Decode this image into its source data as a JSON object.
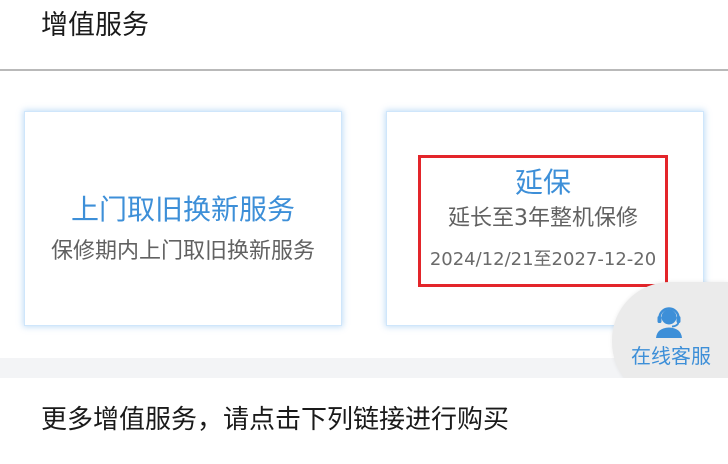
{
  "section": {
    "title": "增值服务"
  },
  "cards": [
    {
      "title": "上门取旧换新服务",
      "subtitle": "保修期内上门取旧换新服务"
    },
    {
      "title": "延保",
      "subtitle": "延长至3年整机保修",
      "date_range": "2024/12/21至2027-12-20"
    }
  ],
  "customer_service": {
    "label": "在线客服",
    "icon": "headset-agent-icon"
  },
  "more": {
    "text": "更多增值服务，请点击下列链接进行购买"
  },
  "colors": {
    "accent": "#3d8fd8",
    "highlight_border": "#e3252a",
    "card_border": "#cfe6fb"
  }
}
